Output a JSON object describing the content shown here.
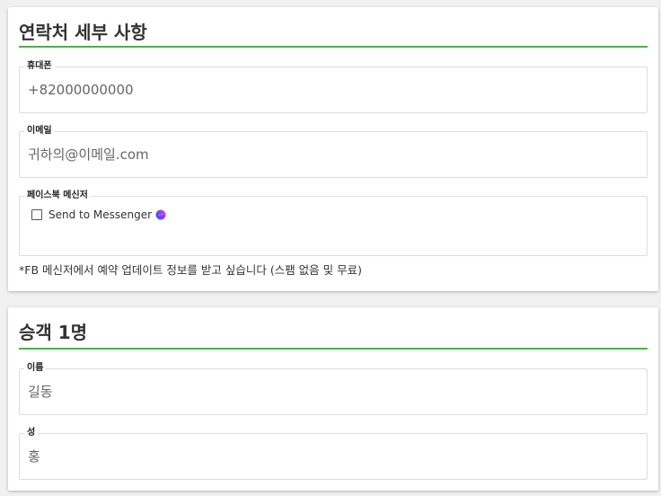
{
  "contact": {
    "title": "연락처 세부 사항",
    "phone": {
      "label": "휴대폰",
      "placeholder": "+82000000000",
      "value": ""
    },
    "email": {
      "label": "이메일",
      "placeholder": "귀하의@이메일.com",
      "value": ""
    },
    "messenger": {
      "label": "페이스북 메신저",
      "checkbox_label": "Send to Messenger",
      "checked": false,
      "icon": "messenger-icon"
    },
    "note": "*FB 메신저에서 예약 업데이트 정보를 받고 싶습니다 (스팸 없음 및 무료)"
  },
  "passenger": {
    "title": "승객 1명",
    "first_name": {
      "label": "이름",
      "placeholder": "길동",
      "value": ""
    },
    "last_name": {
      "label": "성",
      "placeholder": "홍",
      "value": ""
    }
  },
  "colors": {
    "accent": "#4cae4c",
    "border": "#dcdcdc",
    "text": "#333333"
  }
}
